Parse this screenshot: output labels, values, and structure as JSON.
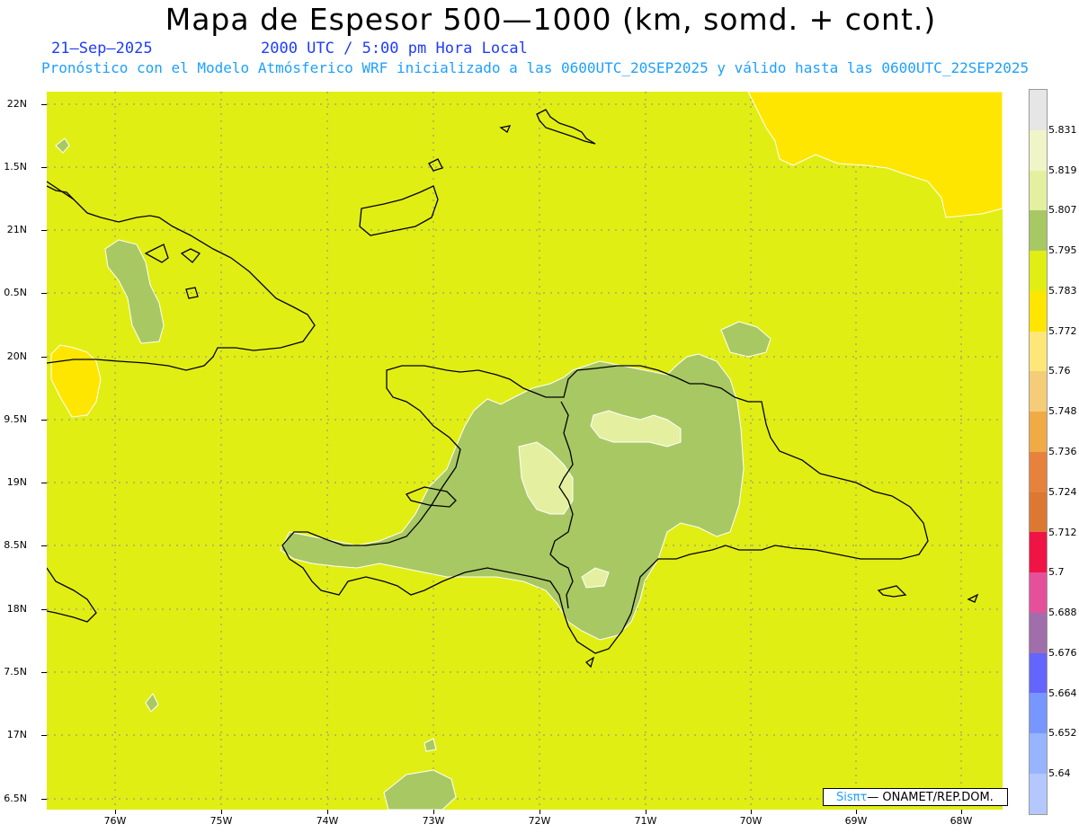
{
  "header": {
    "title": "Mapa de Espesor 500—1000 (km, somd. + cont.)",
    "date": "21—Sep—2025",
    "utc": "2000 UTC / 5:00 pm Hora Local",
    "forecast": "Pronóstico con el Modelo Atmósferico WRF inicializado a las 0600UTC_20SEP2025 y válido hasta las  0600UTC_22SEP2025"
  },
  "axes": {
    "y_labels": [
      "22N",
      "1.5N",
      "21N",
      "0.5N",
      "20N",
      "9.5N",
      "19N",
      "8.5N",
      "18N",
      "7.5N",
      "17N",
      "6.5N"
    ],
    "x_labels": [
      "76W",
      "75W",
      "74W",
      "73W",
      "72W",
      "71W",
      "70W",
      "69W",
      "68W"
    ]
  },
  "legend": {
    "labels": [
      "5.831",
      "5.819",
      "5.807",
      "5.795",
      "5.783",
      "5.772",
      "5.76",
      "5.748",
      "5.736",
      "5.724",
      "5.712",
      "5.7",
      "5.688",
      "5.676",
      "5.664",
      "5.652",
      "5.64"
    ],
    "colors": [
      "#e6e6e6",
      "#f0f5c8",
      "#e4f0a0",
      "#a8c864",
      "#e1ee14",
      "#ffe600",
      "#ffe678",
      "#f5cd78",
      "#f0aa46",
      "#e6823c",
      "#dc7832",
      "#f01446",
      "#e6509b",
      "#a06eaa",
      "#6464ff",
      "#7896ff",
      "#96b4ff",
      "#b4c8ff"
    ]
  },
  "colors": {
    "base_field": "#e1ee14",
    "green_field": "#a8c864",
    "light_field": "#e4f0a0",
    "yellow_field": "#ffe600"
  },
  "credit": {
    "brand": "Sisπτ",
    "text": "— ONAMET/REP.DOM."
  }
}
